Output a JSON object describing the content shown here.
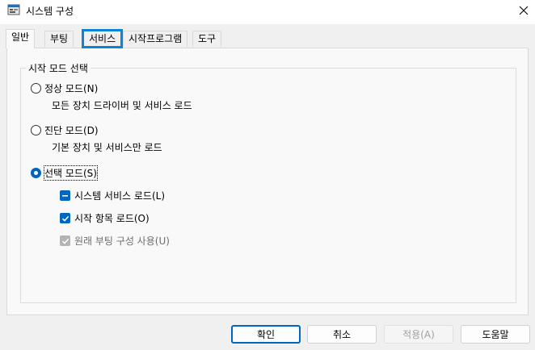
{
  "window": {
    "title": "시스템 구성",
    "icon": "msconfig-icon",
    "close_icon": "close-icon"
  },
  "tabs": [
    {
      "label": "일반",
      "active": true
    },
    {
      "label": "부팅",
      "active": false
    },
    {
      "label": "서비스",
      "active": false,
      "focused": true
    },
    {
      "label": "시작프로그램",
      "active": false
    },
    {
      "label": "도구",
      "active": false
    }
  ],
  "group": {
    "title": "시작 모드 선택",
    "normal": {
      "label": "정상 모드(N)",
      "description": "모든 장치 드라이버 및 서비스 로드",
      "selected": false
    },
    "diagnostic": {
      "label": "진단 모드(D)",
      "description": "기본 장치 및 서비스만 로드",
      "selected": false
    },
    "selective": {
      "label": "선택 모드(S)",
      "selected": true,
      "load_system_services": {
        "label": "시스템 서비스 로드(L)",
        "state": "indeterminate"
      },
      "load_startup_items": {
        "label": "시작 항목 로드(O)",
        "state": "checked"
      },
      "use_original_boot": {
        "label": "원래 부팅 구성 사용(U)",
        "state": "checked-disabled"
      }
    }
  },
  "buttons": {
    "ok": "확인",
    "cancel": "취소",
    "apply": "적용(A)",
    "help": "도움말"
  },
  "colors": {
    "accent": "#0067c0",
    "focus_highlight": "#0b84d6"
  }
}
